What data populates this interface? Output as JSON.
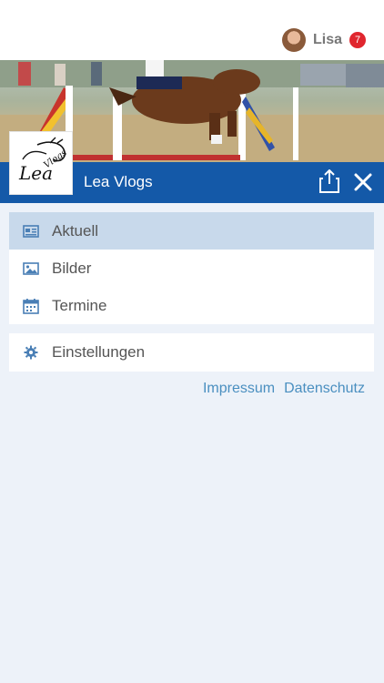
{
  "user": {
    "name": "Lisa",
    "notification_count": "7"
  },
  "channel": {
    "title": "Lea Vlogs"
  },
  "menu": {
    "items": [
      {
        "label": "Aktuell",
        "icon": "newspaper-icon",
        "active": true
      },
      {
        "label": "Bilder",
        "icon": "image-icon",
        "active": false
      },
      {
        "label": "Termine",
        "icon": "calendar-icon",
        "active": false
      }
    ],
    "settings_label": "Einstellungen"
  },
  "footer": {
    "impressum": "Impressum",
    "datenschutz": "Datenschutz"
  },
  "colors": {
    "primary": "#1459a8",
    "active_bg": "#c8d9eb",
    "page_bg": "#edf2f9",
    "badge": "#e0262e",
    "link": "#4a8fc0"
  }
}
